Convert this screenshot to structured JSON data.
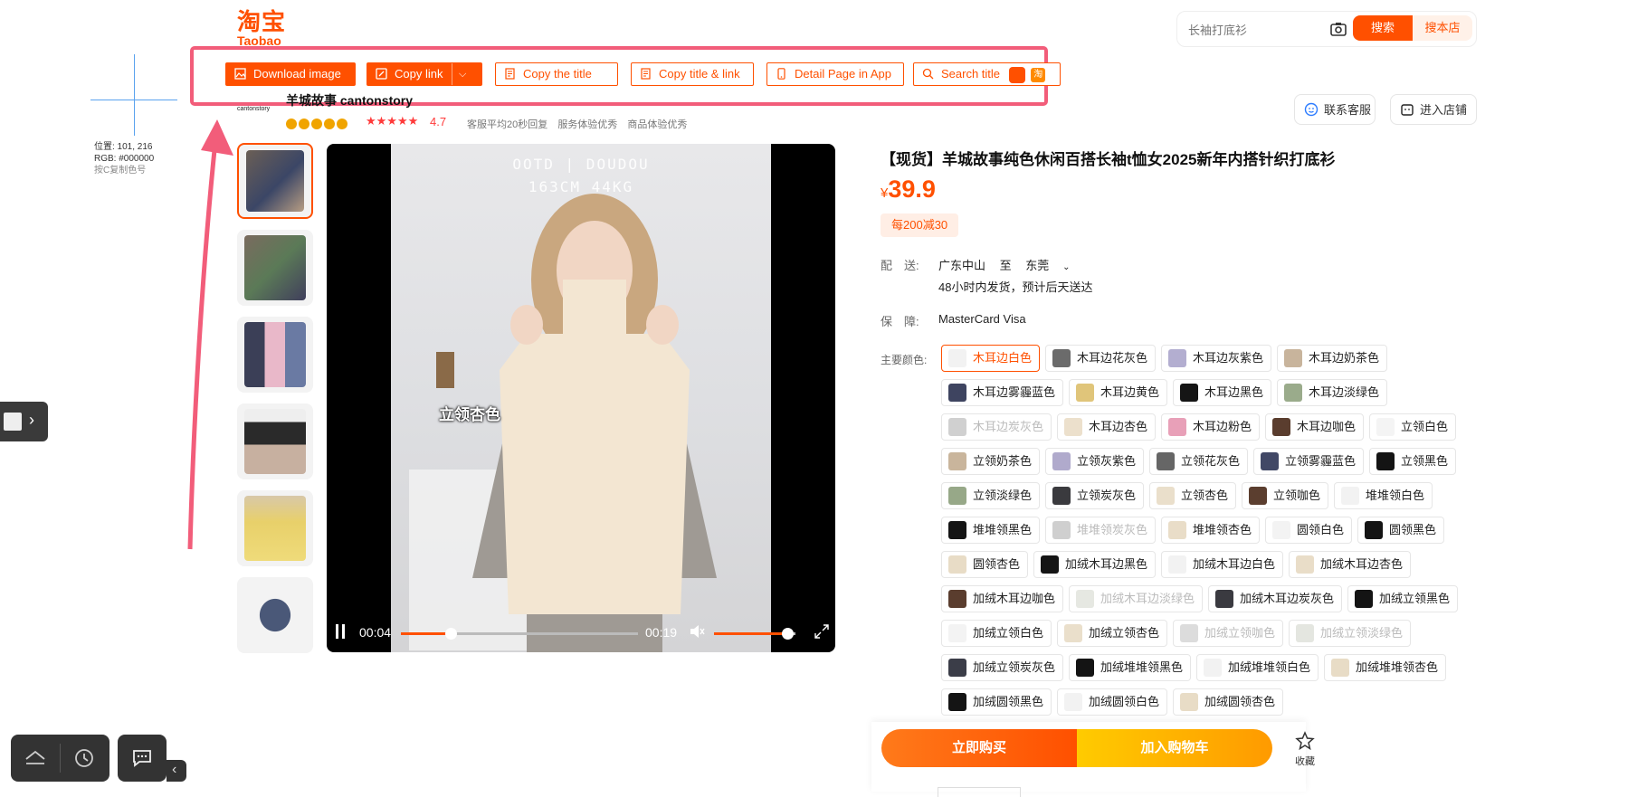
{
  "header": {
    "logo_cn": "淘宝",
    "logo_en": "Taobao",
    "search": {
      "placeholder": "长袖打底衫",
      "search_label": "搜索",
      "shop_label": "搜本店"
    }
  },
  "toolbar": {
    "download_image": "Download image",
    "copy_link": "Copy link",
    "copy_title": "Copy the title",
    "copy_title_link": "Copy title & link",
    "detail_in_app": "Detail Page in App",
    "search_title": "Search title",
    "taobao_badge": "淘"
  },
  "picker": {
    "position": "位置: 101, 216",
    "rgb": "RGB: #000000",
    "hint": "按C复制色号"
  },
  "shop": {
    "logo_text": "cantonstory",
    "name": "羊城故事 cantonstory",
    "rating": "4.7",
    "services": [
      "客服平均20秒回复",
      "服务体验优秀",
      "商品体验优秀"
    ],
    "customer_service": "联系客服",
    "enter_store": "进入店铺"
  },
  "video": {
    "overlay_line1": "OOTD | DOUDOU",
    "overlay_line2": "163CM 44KG",
    "caption": "立领杏色",
    "current_time": "00:04",
    "duration": "00:19",
    "progress": 0.21,
    "volume": 0.9
  },
  "product": {
    "title": "【现货】羊城故事纯色休闲百搭长袖t恤女2025新年内搭针织打底衫",
    "price_symbol": "¥",
    "price": "39.9",
    "coupon": "每200减30",
    "shipping_label": "配　送:",
    "ship_from": "广东中山",
    "ship_to_word": "至",
    "ship_to": "东莞",
    "ship_note": "48小时内发货，预计后天送达",
    "guarantee_label": "保　障:",
    "guarantee": "MasterCard Visa",
    "color_label": "主要颜色:",
    "colors": [
      {
        "label": "木耳边白色",
        "swatch": "#f2f2f2",
        "state": "selected"
      },
      {
        "label": "木耳边花灰色",
        "swatch": "#6b6b6b",
        "state": "normal"
      },
      {
        "label": "木耳边灰紫色",
        "swatch": "#b3aed0",
        "state": "normal"
      },
      {
        "label": "木耳边奶茶色",
        "swatch": "#c8b49c",
        "state": "normal"
      },
      {
        "label": "木耳边雾霾蓝色",
        "swatch": "#3e4460",
        "state": "normal"
      },
      {
        "label": "木耳边黄色",
        "swatch": "#e0c57a",
        "state": "normal"
      },
      {
        "label": "木耳边黑色",
        "swatch": "#151515",
        "state": "normal"
      },
      {
        "label": "木耳边淡绿色",
        "swatch": "#9aab8b",
        "state": "normal"
      },
      {
        "label": "木耳边炭灰色",
        "swatch": "#d0d0d0",
        "state": "disabled"
      },
      {
        "label": "木耳边杏色",
        "swatch": "#ece0cc",
        "state": "normal"
      },
      {
        "label": "木耳边粉色",
        "swatch": "#e8a0b8",
        "state": "normal"
      },
      {
        "label": "木耳边咖色",
        "swatch": "#5a3d2e",
        "state": "normal"
      },
      {
        "label": "立领白色",
        "swatch": "#f4f4f4",
        "state": "normal"
      },
      {
        "label": "立领奶茶色",
        "swatch": "#c9b59c",
        "state": "normal"
      },
      {
        "label": "立领灰紫色",
        "swatch": "#b0aacc",
        "state": "normal"
      },
      {
        "label": "立领花灰色",
        "swatch": "#666666",
        "state": "normal"
      },
      {
        "label": "立领雾霾蓝色",
        "swatch": "#414866",
        "state": "normal"
      },
      {
        "label": "立领黑色",
        "swatch": "#141414",
        "state": "normal"
      },
      {
        "label": "立领淡绿色",
        "swatch": "#97a888",
        "state": "normal"
      },
      {
        "label": "立领炭灰色",
        "swatch": "#3a3a3e",
        "state": "normal"
      },
      {
        "label": "立领杏色",
        "swatch": "#eadfcb",
        "state": "normal"
      },
      {
        "label": "立领咖色",
        "swatch": "#5b3e2f",
        "state": "normal"
      },
      {
        "label": "堆堆领白色",
        "swatch": "#f2f2f2",
        "state": "normal"
      },
      {
        "label": "堆堆领黑色",
        "swatch": "#141414",
        "state": "normal"
      },
      {
        "label": "堆堆领炭灰色",
        "swatch": "#cfcfcf",
        "state": "disabled"
      },
      {
        "label": "堆堆领杏色",
        "swatch": "#e9ddc8",
        "state": "normal"
      },
      {
        "label": "圆领白色",
        "swatch": "#f3f3f3",
        "state": "normal"
      },
      {
        "label": "圆领黑色",
        "swatch": "#141414",
        "state": "normal"
      },
      {
        "label": "圆领杏色",
        "swatch": "#e8dcc6",
        "state": "normal"
      },
      {
        "label": "加绒木耳边黑色",
        "swatch": "#151515",
        "state": "normal"
      },
      {
        "label": "加绒木耳边白色",
        "swatch": "#f2f2f2",
        "state": "normal"
      },
      {
        "label": "加绒木耳边杏色",
        "swatch": "#e9ddc8",
        "state": "normal"
      },
      {
        "label": "加绒木耳边咖色",
        "swatch": "#5a3d2e",
        "state": "normal"
      },
      {
        "label": "加绒木耳边淡绿色",
        "swatch": "#e6e8e2",
        "state": "disabled"
      },
      {
        "label": "加绒木耳边炭灰色",
        "swatch": "#3a3a40",
        "state": "normal"
      },
      {
        "label": "加绒立领黑色",
        "swatch": "#141414",
        "state": "normal"
      },
      {
        "label": "加绒立领白色",
        "swatch": "#f3f3f3",
        "state": "normal"
      },
      {
        "label": "加绒立领杏色",
        "swatch": "#eadfcb",
        "state": "normal"
      },
      {
        "label": "加绒立领咖色",
        "swatch": "#dcdcdc",
        "state": "disabled"
      },
      {
        "label": "加绒立领淡绿色",
        "swatch": "#e4e6e0",
        "state": "disabled"
      },
      {
        "label": "加绒立领炭灰色",
        "swatch": "#3b3d48",
        "state": "normal"
      },
      {
        "label": "加绒堆堆领黑色",
        "swatch": "#141414",
        "state": "normal"
      },
      {
        "label": "加绒堆堆领白色",
        "swatch": "#f2f2f2",
        "state": "normal"
      },
      {
        "label": "加绒堆堆领杏色",
        "swatch": "#e8dcc6",
        "state": "normal"
      },
      {
        "label": "加绒圆领黑色",
        "swatch": "#141414",
        "state": "normal"
      },
      {
        "label": "加绒圆领白色",
        "swatch": "#f2f2f2",
        "state": "normal"
      },
      {
        "label": "加绒圆领杏色",
        "swatch": "#e8dcc6",
        "state": "normal"
      }
    ],
    "buy_now": "立即购买",
    "add_cart": "加入购物车",
    "favorite": "收藏"
  },
  "colors": {
    "brand": "#ff5000",
    "highlight_border": "#f25d7a"
  }
}
